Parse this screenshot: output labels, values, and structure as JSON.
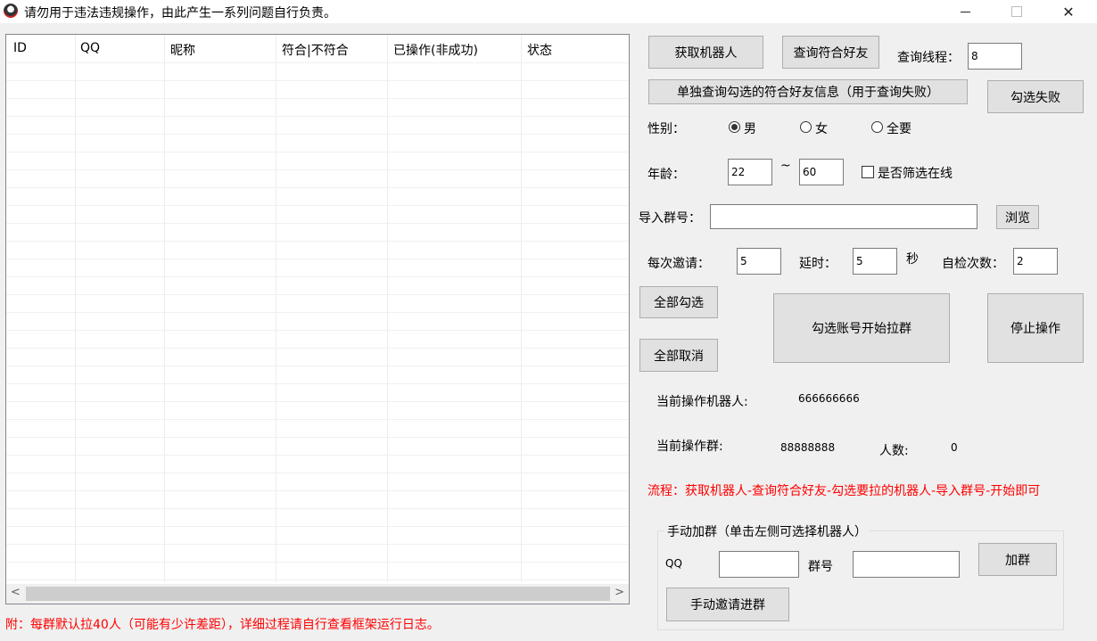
{
  "window": {
    "title": "请勿用于违法违规操作，由此产生一系列问题自行负责。",
    "minimize_symbol": "—",
    "close_symbol": "✕"
  },
  "grid": {
    "columns": [
      "ID",
      "QQ",
      "昵称",
      "符合|不符合",
      "已操作(非成功)",
      "状态"
    ],
    "scroll_left": "<",
    "scroll_right": ">"
  },
  "buttons": {
    "get_robot": "获取机器人",
    "query_friends": "查询符合好友",
    "single_query": "单独查询勾选的符合好友信息（用于查询失败）",
    "check_failed": "勾选失败",
    "browse": "浏览",
    "select_all": "全部勾选",
    "cancel_all": "全部取消",
    "start_pull": "勾选账号开始拉群",
    "stop": "停止操作",
    "add_group": "加群",
    "manual_invite": "手动邀请进群"
  },
  "fields": {
    "threads_label": "查询线程：",
    "threads_value": "8",
    "gender_label": "性别：",
    "gender_options": [
      "男",
      "女",
      "全要"
    ],
    "gender_selected": "男",
    "age_label": "年龄：",
    "age_min": "22",
    "age_sep": "~",
    "age_max": "60",
    "online_label": "是否筛选在线",
    "import_label": "导入群号：",
    "import_value": "",
    "invite_label": "每次邀请：",
    "invite_value": "5",
    "delay_label": "延时：",
    "delay_value": "5",
    "delay_unit": "秒",
    "selfcheck_label": "自检次数：",
    "selfcheck_value": "2"
  },
  "status": {
    "robot_label": "当前操作机器人:",
    "robot_value": "666666666",
    "group_label": "当前操作群:",
    "group_value": "88888888",
    "count_label": "人数:",
    "count_value": "0",
    "flow": "流程：获取机器人-查询符合好友-勾选要拉的机器人-导入群号-开始即可",
    "note": "附：每群默认拉40人（可能有少许差距），详细过程请自行查看框架运行日志。"
  },
  "manual": {
    "title": "手动加群（单击左侧可选择机器人）",
    "qq_label": "QQ",
    "qq_value": "",
    "group_label": "群号",
    "group_value": ""
  }
}
